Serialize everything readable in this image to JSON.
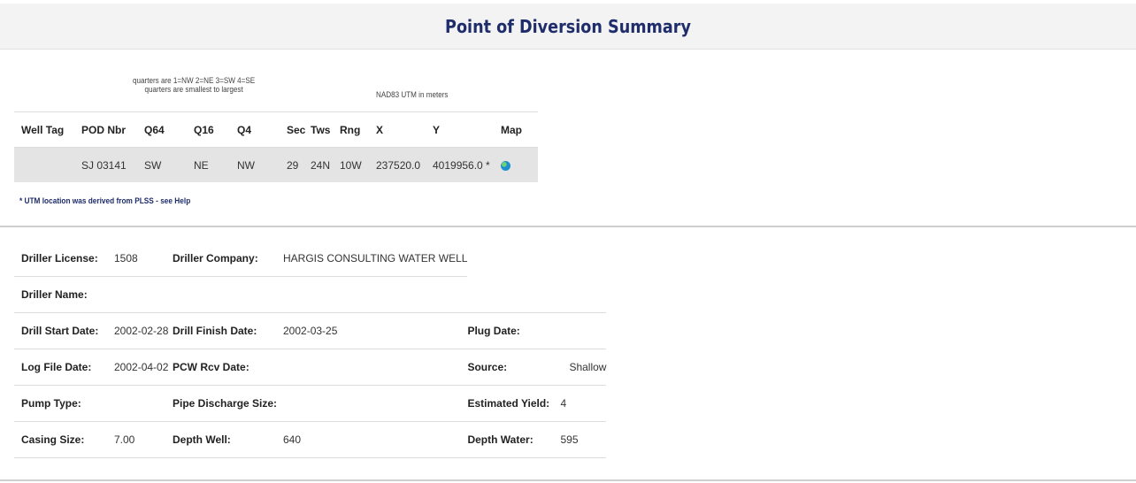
{
  "page": {
    "title": "Point of Diversion Summary"
  },
  "notes": {
    "quarters_line1": "quarters are 1=NW 2=NE 3=SW 4=SE",
    "quarters_line2": "quarters are smallest to largest",
    "utm_units": "NAD83 UTM in meters",
    "utm_footnote": "* UTM location was derived from PLSS - see Help"
  },
  "pod_table": {
    "headers": [
      "Well Tag",
      "POD Nbr",
      "Q64",
      "Q16",
      "Q4",
      "Sec",
      "Tws",
      "Rng",
      "X",
      "Y",
      "Map"
    ],
    "row": {
      "well_tag": "",
      "pod_nbr": "SJ 03141",
      "q64": "SW",
      "q16": "NE",
      "q4": "NW",
      "sec": "29",
      "tws": "24N",
      "rng": "10W",
      "x": "237520.0",
      "y": "4019956.0 *",
      "map_icon": "globe-icon"
    }
  },
  "driller": {
    "license_label": "Driller License:",
    "license": "1508",
    "company_label": "Driller Company:",
    "company": "HARGIS CONSULTING WATER WELL",
    "name_label": "Driller Name:",
    "name": "",
    "drill_start_label": "Drill Start Date:",
    "drill_start": "2002-02-28",
    "drill_finish_label": "Drill Finish Date:",
    "drill_finish": "2002-03-25",
    "plug_date_label": "Plug Date:",
    "plug_date": "",
    "log_file_label": "Log File Date:",
    "log_file": "2002-04-02",
    "pcw_rcv_label": "PCW Rcv Date:",
    "pcw_rcv": "",
    "source_label": "Source:",
    "source": "Shallow",
    "pump_type_label": "Pump Type:",
    "pump_type": "",
    "pipe_discharge_label": "Pipe Discharge Size:",
    "pipe_discharge": "",
    "estimated_yield_label": "Estimated Yield:",
    "estimated_yield": "4",
    "casing_size_label": "Casing Size:",
    "casing_size": "7.00",
    "depth_well_label": "Depth Well:",
    "depth_well": "640",
    "depth_water_label": "Depth Water:",
    "depth_water": "595"
  }
}
